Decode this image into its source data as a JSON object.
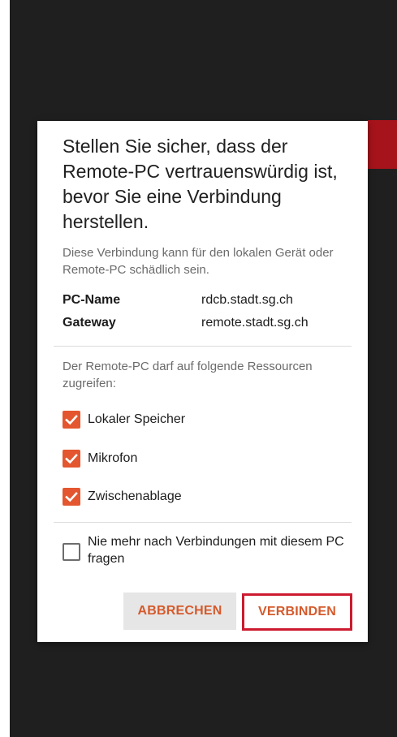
{
  "dialog": {
    "title": "Stellen Sie sicher, dass der Remote-PC vertrauenswürdig ist, bevor Sie eine Verbindung herstellen.",
    "warning": "Diese Verbindung kann für den lokalen Gerät oder Remote-PC schädlich sein.",
    "info": {
      "pc_name_label": "PC-Name",
      "pc_name_value": "rdcb.stadt.sg.ch",
      "gateway_label": "Gateway",
      "gateway_value": "remote.stadt.sg.ch"
    },
    "resources_intro": "Der Remote-PC darf auf folgende Ressourcen zugreifen:",
    "resources": [
      {
        "label": "Lokaler Speicher",
        "checked": true
      },
      {
        "label": "Mikrofon",
        "checked": true
      },
      {
        "label": "Zwischenablage",
        "checked": true
      }
    ],
    "never_ask": {
      "label": "Nie mehr nach Verbindungen mit diesem PC fragen",
      "checked": false
    },
    "buttons": {
      "cancel": "ABBRECHEN",
      "connect": "VERBINDEN"
    }
  },
  "colors": {
    "accent": "#e4562f",
    "button_text": "#d55a2c",
    "highlight_border": "#cc1a2f",
    "backdrop": "#1f1f1f"
  },
  "icons": {
    "checked": "check-icon",
    "unchecked": "empty-checkbox-icon"
  }
}
